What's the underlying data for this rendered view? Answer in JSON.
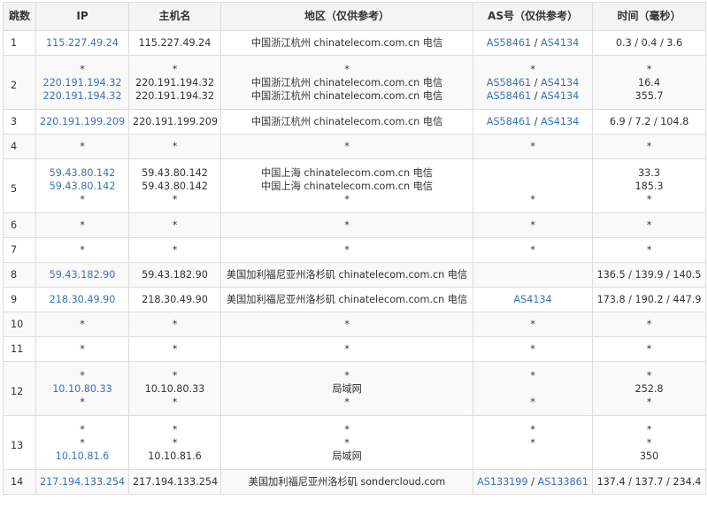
{
  "headers": [
    "跳数",
    "IP",
    "主机名",
    "地区（仅供参考）",
    "AS号（仅供参考）",
    "时间（毫秒）"
  ],
  "rows": [
    {
      "hop": "1",
      "lines": [
        {
          "ip": "115.227.49.24",
          "host": "115.227.49.24",
          "region": "中国浙江杭州 chinatelecom.com.cn 电信",
          "as": [
            "AS58461",
            "AS4134"
          ],
          "time": "0.3 / 0.4 / 3.6"
        }
      ]
    },
    {
      "hop": "2",
      "lines": [
        {
          "ip": "*",
          "host": "*",
          "region": "*",
          "as": [
            "*"
          ],
          "time": "*"
        },
        {
          "ip": "220.191.194.32",
          "host": "220.191.194.32",
          "region": "中国浙江杭州 chinatelecom.com.cn 电信",
          "as": [
            "AS58461",
            "AS4134"
          ],
          "time": "16.4"
        },
        {
          "ip": "220.191.194.32",
          "host": "220.191.194.32",
          "region": "中国浙江杭州 chinatelecom.com.cn 电信",
          "as": [
            "AS58461",
            "AS4134"
          ],
          "time": "355.7"
        }
      ]
    },
    {
      "hop": "3",
      "lines": [
        {
          "ip": "220.191.199.209",
          "host": "220.191.199.209",
          "region": "中国浙江杭州 chinatelecom.com.cn 电信",
          "as": [
            "AS58461",
            "AS4134"
          ],
          "time": "6.9 / 7.2 / 104.8"
        }
      ]
    },
    {
      "hop": "4",
      "lines": [
        {
          "ip": "*",
          "host": "*",
          "region": "*",
          "as": [
            "*"
          ],
          "time": "*"
        }
      ]
    },
    {
      "hop": "5",
      "lines": [
        {
          "ip": "59.43.80.142",
          "host": "59.43.80.142",
          "region": "中国上海 chinatelecom.com.cn 电信",
          "as": [],
          "time": "33.3"
        },
        {
          "ip": "59.43.80.142",
          "host": "59.43.80.142",
          "region": "中国上海 chinatelecom.com.cn 电信",
          "as": [],
          "time": "185.3"
        },
        {
          "ip": "*",
          "host": "*",
          "region": "*",
          "as": [
            "*"
          ],
          "time": "*"
        }
      ]
    },
    {
      "hop": "6",
      "lines": [
        {
          "ip": "*",
          "host": "*",
          "region": "*",
          "as": [
            "*"
          ],
          "time": "*"
        }
      ]
    },
    {
      "hop": "7",
      "lines": [
        {
          "ip": "*",
          "host": "*",
          "region": "*",
          "as": [
            "*"
          ],
          "time": "*"
        }
      ]
    },
    {
      "hop": "8",
      "lines": [
        {
          "ip": "59.43.182.90",
          "host": "59.43.182.90",
          "region": "美国加利福尼亚州洛杉矶 chinatelecom.com.cn 电信",
          "as": [],
          "time": "136.5 / 139.9 / 140.5"
        }
      ]
    },
    {
      "hop": "9",
      "lines": [
        {
          "ip": "218.30.49.90",
          "host": "218.30.49.90",
          "region": "美国加利福尼亚州洛杉矶 chinatelecom.com.cn 电信",
          "as": [
            "AS4134"
          ],
          "time": "173.8 / 190.2 / 447.9"
        }
      ]
    },
    {
      "hop": "10",
      "lines": [
        {
          "ip": "*",
          "host": "*",
          "region": "*",
          "as": [
            "*"
          ],
          "time": "*"
        }
      ]
    },
    {
      "hop": "11",
      "lines": [
        {
          "ip": "*",
          "host": "*",
          "region": "*",
          "as": [
            "*"
          ],
          "time": "*"
        }
      ]
    },
    {
      "hop": "12",
      "lines": [
        {
          "ip": "*",
          "host": "*",
          "region": "*",
          "as": [
            "*"
          ],
          "time": "*"
        },
        {
          "ip": "10.10.80.33",
          "host": "10.10.80.33",
          "region": "局域网",
          "as": [],
          "time": "252.8"
        },
        {
          "ip": "*",
          "host": "*",
          "region": "*",
          "as": [
            "*"
          ],
          "time": "*"
        }
      ]
    },
    {
      "hop": "13",
      "lines": [
        {
          "ip": "*",
          "host": "*",
          "region": "*",
          "as": [
            "*"
          ],
          "time": "*"
        },
        {
          "ip": "*",
          "host": "*",
          "region": "*",
          "as": [
            "*"
          ],
          "time": "*"
        },
        {
          "ip": "10.10.81.6",
          "host": "10.10.81.6",
          "region": "局域网",
          "as": [],
          "time": "350"
        }
      ]
    },
    {
      "hop": "14",
      "lines": [
        {
          "ip": "217.194.133.254",
          "host": "217.194.133.254",
          "region": "美国加利福尼亚州洛杉矶 sondercloud.com",
          "as": [
            "AS133199",
            "AS133861"
          ],
          "time": "137.4 / 137.7 / 234.4"
        }
      ]
    }
  ],
  "colors": {
    "link": "#3a72b5",
    "header_bg": "#f4f4f4",
    "stripe_bg": "#f9f9f9",
    "border": "#dddddd"
  }
}
